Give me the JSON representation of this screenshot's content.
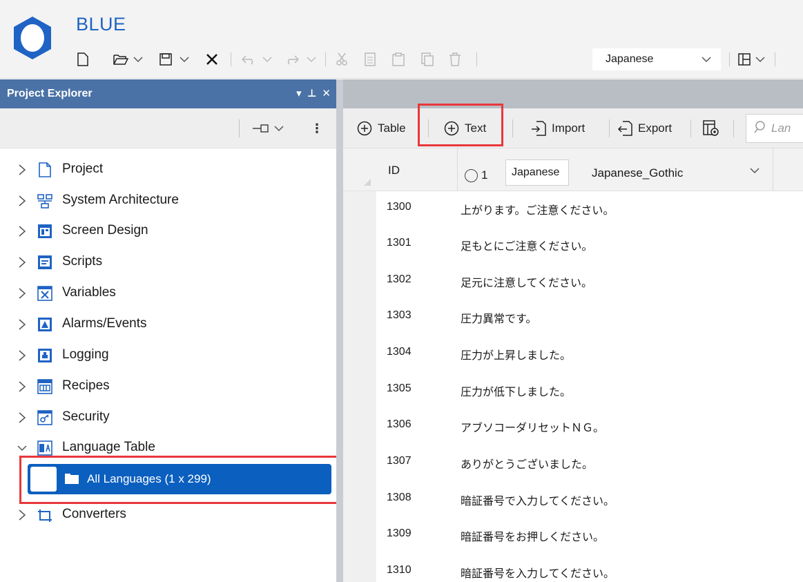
{
  "app": {
    "title": "BLUE",
    "accent": "#1f63c4"
  },
  "toolbar": {
    "language_value": "Japanese"
  },
  "project_explorer": {
    "title": "Project Explorer",
    "header_color": "#4a72a6",
    "items": [
      {
        "label": "Project",
        "icon": "document-icon"
      },
      {
        "label": "System Architecture",
        "icon": "network-icon"
      },
      {
        "label": "Screen Design",
        "icon": "screen-design-icon"
      },
      {
        "label": "Scripts",
        "icon": "scripts-icon"
      },
      {
        "label": "Variables",
        "icon": "variables-icon"
      },
      {
        "label": "Alarms/Events",
        "icon": "alarm-icon"
      },
      {
        "label": "Logging",
        "icon": "logging-icon"
      },
      {
        "label": "Recipes",
        "icon": "recipes-icon"
      },
      {
        "label": "Security",
        "icon": "security-icon"
      },
      {
        "label": "Language Table",
        "icon": "language-table-icon",
        "expanded": true
      },
      {
        "label": "Converters",
        "icon": "converters-icon"
      }
    ],
    "selected_child": {
      "label": "All Languages (1 x 299)",
      "icon": "folder-icon"
    }
  },
  "language_toolbar": {
    "table_label": "Table",
    "text_label": "Text",
    "import_label": "Import",
    "export_label": "Export",
    "search_placeholder": "Lan"
  },
  "grid": {
    "id_header": "ID",
    "radio_number": "1",
    "language_input": "Japanese",
    "font_value": "Japanese_Gothic",
    "rows": [
      {
        "id": "1300",
        "text": "上がります。ご注意ください。"
      },
      {
        "id": "1301",
        "text": "足もとにご注意ください。"
      },
      {
        "id": "1302",
        "text": "足元に注意してください。"
      },
      {
        "id": "1303",
        "text": "圧力異常です。"
      },
      {
        "id": "1304",
        "text": "圧力が上昇しました。"
      },
      {
        "id": "1305",
        "text": "圧力が低下しました。"
      },
      {
        "id": "1306",
        "text": "アブソコーダリセットＮＧ。"
      },
      {
        "id": "1307",
        "text": "ありがとうございました。"
      },
      {
        "id": "1308",
        "text": "暗証番号で入力してください。"
      },
      {
        "id": "1309",
        "text": "暗証番号をお押しください。"
      },
      {
        "id": "1310",
        "text": "暗証番号を入力してください。"
      }
    ]
  },
  "highlight_color": "#e8373b",
  "selection_color": "#0a5fbf"
}
